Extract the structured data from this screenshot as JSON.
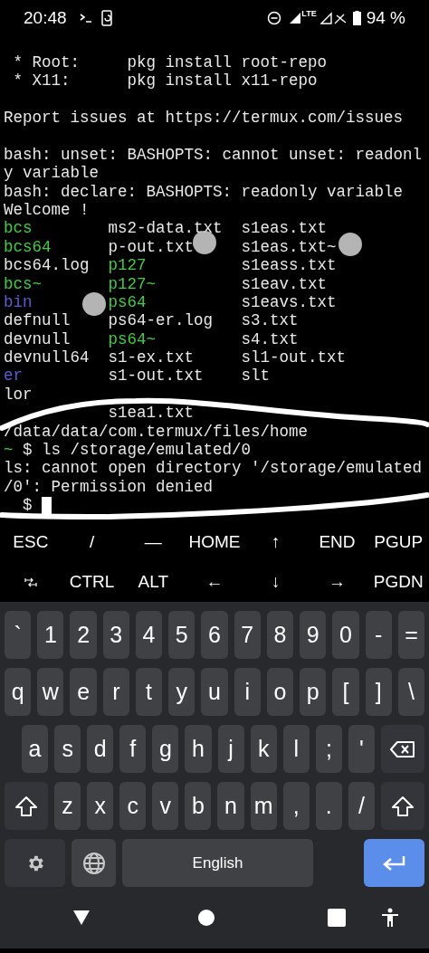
{
  "status_bar": {
    "time": "20:48",
    "network": "LTE",
    "battery": "94 %"
  },
  "terminal": {
    "lines": [
      {
        "kind": "text",
        "text": " * Root:     pkg install root-repo"
      },
      {
        "kind": "text",
        "text": " * X11:      pkg install x11-repo"
      },
      {
        "kind": "blank"
      },
      {
        "kind": "text",
        "text": "Report issues at https://termux.com/issues"
      },
      {
        "kind": "blank"
      },
      {
        "kind": "text",
        "text": "bash: unset: BASHOPTS: cannot unset: readonl"
      },
      {
        "kind": "text",
        "text": "y variable"
      },
      {
        "kind": "text",
        "text": "bash: declare: BASHOPTS: readonly variable"
      },
      {
        "kind": "text",
        "text": "Welcome !"
      },
      {
        "kind": "ls",
        "cells": [
          {
            "text": "bcs",
            "color": "#3fcf3f"
          },
          {
            "text": "ms2-data.txt",
            "color": "#e8e8e8"
          },
          {
            "text": "s1eas.txt",
            "color": "#e8e8e8"
          }
        ]
      },
      {
        "kind": "ls",
        "cells": [
          {
            "text": "bcs64",
            "color": "#3fcf3f"
          },
          {
            "text": "p-out.txt",
            "color": "#e8e8e8"
          },
          {
            "text": "s1eas.txt~",
            "color": "#e8e8e8"
          }
        ]
      },
      {
        "kind": "ls",
        "cells": [
          {
            "text": "bcs64.log",
            "color": "#e8e8e8"
          },
          {
            "text": "p127",
            "color": "#3fcf3f"
          },
          {
            "text": "s1eass.txt",
            "color": "#e8e8e8"
          }
        ]
      },
      {
        "kind": "ls",
        "cells": [
          {
            "text": "bcs~",
            "color": "#3fcf3f"
          },
          {
            "text": "p127~",
            "color": "#3fcf3f"
          },
          {
            "text": "s1eav.txt",
            "color": "#e8e8e8"
          }
        ]
      },
      {
        "kind": "ls",
        "cells": [
          {
            "text": "bin",
            "color": "#5c5cd6"
          },
          {
            "text": "ps64",
            "color": "#3fcf3f"
          },
          {
            "text": "s1eavs.txt",
            "color": "#e8e8e8"
          }
        ]
      },
      {
        "kind": "ls",
        "cells": [
          {
            "text": "defnull",
            "color": "#e8e8e8"
          },
          {
            "text": "ps64-er.log",
            "color": "#e8e8e8"
          },
          {
            "text": "s3.txt",
            "color": "#e8e8e8"
          }
        ]
      },
      {
        "kind": "ls",
        "cells": [
          {
            "text": "devnull",
            "color": "#e8e8e8"
          },
          {
            "text": "ps64~",
            "color": "#3fcf3f"
          },
          {
            "text": "s4.txt",
            "color": "#e8e8e8"
          }
        ]
      },
      {
        "kind": "ls",
        "cells": [
          {
            "text": "devnull64",
            "color": "#e8e8e8"
          },
          {
            "text": "s1-ex.txt",
            "color": "#e8e8e8"
          },
          {
            "text": "sl1-out.txt",
            "color": "#e8e8e8"
          }
        ]
      },
      {
        "kind": "ls",
        "cells": [
          {
            "text": "er",
            "color": "#5c5cd6"
          },
          {
            "text": "s1-out.txt",
            "color": "#e8e8e8"
          },
          {
            "text": "slt",
            "color": "#e8e8e8"
          }
        ]
      },
      {
        "kind": "ls",
        "cells": [
          {
            "text": "lor",
            "color": "#e8e8e8"
          }
        ]
      },
      {
        "kind": "ls_indented",
        "cells": [
          {
            "text": "s1ea1.txt",
            "color": "#e8e8e8"
          }
        ]
      },
      {
        "kind": "text",
        "text": "/data/data/com.termux/files/home"
      },
      {
        "kind": "prompt",
        "dir": "~",
        "symbol": "$",
        "command": "ls /storage/emulated/0"
      },
      {
        "kind": "text",
        "text": "ls: cannot open directory '/storage/emulated"
      },
      {
        "kind": "text",
        "text": "/0': Permission denied"
      },
      {
        "kind": "prompt",
        "symbol": "$",
        "cursor": true
      }
    ]
  },
  "extra_keys": [
    [
      {
        "kind": "text",
        "label": "ESC"
      },
      {
        "kind": "text",
        "label": "/"
      },
      {
        "kind": "text",
        "label": "―"
      },
      {
        "kind": "text",
        "label": "HOME"
      },
      {
        "kind": "text",
        "label": "↑"
      },
      {
        "kind": "text",
        "label": "END"
      },
      {
        "kind": "text",
        "label": "PGUP"
      }
    ],
    [
      {
        "kind": "tab"
      },
      {
        "kind": "text",
        "label": "CTRL"
      },
      {
        "kind": "text",
        "label": "ALT"
      },
      {
        "kind": "text",
        "label": "←"
      },
      {
        "kind": "text",
        "label": "↓"
      },
      {
        "kind": "text",
        "label": "→"
      },
      {
        "kind": "text",
        "label": "PGDN"
      }
    ]
  ],
  "keyboard": {
    "rows": [
      {
        "keys": [
          {
            "kind": "char",
            "label": "`"
          },
          {
            "kind": "char",
            "label": "1"
          },
          {
            "kind": "char",
            "label": "2"
          },
          {
            "kind": "char",
            "label": "3"
          },
          {
            "kind": "char",
            "label": "4"
          },
          {
            "kind": "char",
            "label": "5"
          },
          {
            "kind": "char",
            "label": "6"
          },
          {
            "kind": "char",
            "label": "7"
          },
          {
            "kind": "char",
            "label": "8"
          },
          {
            "kind": "char",
            "label": "9"
          },
          {
            "kind": "char",
            "label": "0"
          },
          {
            "kind": "char",
            "label": "-"
          },
          {
            "kind": "char",
            "label": "="
          }
        ]
      },
      {
        "keys": [
          {
            "kind": "char",
            "label": "q"
          },
          {
            "kind": "char",
            "label": "w"
          },
          {
            "kind": "char",
            "label": "e"
          },
          {
            "kind": "char",
            "label": "r"
          },
          {
            "kind": "char",
            "label": "t"
          },
          {
            "kind": "char",
            "label": "y"
          },
          {
            "kind": "char",
            "label": "u"
          },
          {
            "kind": "char",
            "label": "i"
          },
          {
            "kind": "char",
            "label": "o"
          },
          {
            "kind": "char",
            "label": "p"
          },
          {
            "kind": "char",
            "label": "["
          },
          {
            "kind": "char",
            "label": "]"
          },
          {
            "kind": "char",
            "label": "\\"
          }
        ]
      },
      {
        "keys": [
          {
            "kind": "char",
            "label": "a"
          },
          {
            "kind": "char",
            "label": "s"
          },
          {
            "kind": "char",
            "label": "d"
          },
          {
            "kind": "char",
            "label": "f"
          },
          {
            "kind": "char",
            "label": "g"
          },
          {
            "kind": "char",
            "label": "h"
          },
          {
            "kind": "char",
            "label": "j"
          },
          {
            "kind": "char",
            "label": "k"
          },
          {
            "kind": "char",
            "label": "l"
          },
          {
            "kind": "char",
            "label": ";"
          },
          {
            "kind": "char",
            "label": "'"
          },
          {
            "kind": "backspace"
          }
        ]
      },
      {
        "keys": [
          {
            "kind": "shift"
          },
          {
            "kind": "char",
            "label": "z"
          },
          {
            "kind": "char",
            "label": "x"
          },
          {
            "kind": "char",
            "label": "c"
          },
          {
            "kind": "char",
            "label": "v"
          },
          {
            "kind": "char",
            "label": "b"
          },
          {
            "kind": "char",
            "label": "n"
          },
          {
            "kind": "char",
            "label": "m"
          },
          {
            "kind": "char",
            "label": ","
          },
          {
            "kind": "char",
            "label": "."
          },
          {
            "kind": "char",
            "label": "/"
          },
          {
            "kind": "shift"
          }
        ]
      },
      {
        "keys": [
          {
            "kind": "settings"
          },
          {
            "kind": "language"
          },
          {
            "kind": "space",
            "label": "English"
          },
          {
            "kind": "enter"
          }
        ]
      }
    ]
  }
}
